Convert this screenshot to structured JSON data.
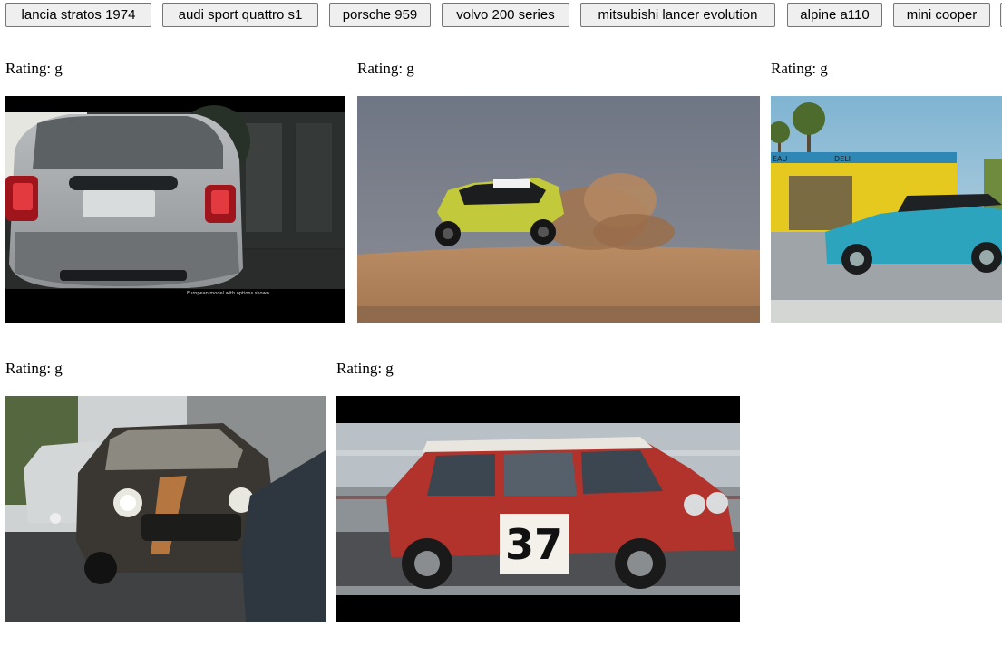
{
  "search_buttons": [
    {
      "label": "lancia stratos 1974"
    },
    {
      "label": "audi sport quattro s1"
    },
    {
      "label": "porsche 959"
    },
    {
      "label": "volvo 200 series"
    },
    {
      "label": "mitsubishi lancer evolution"
    },
    {
      "label": "alpine a110"
    },
    {
      "label": "mini cooper"
    }
  ],
  "results": [
    {
      "rating": "Rating: g",
      "overlay_text": "European model with options shown.",
      "plate_text": ""
    },
    {
      "rating": "Rating: g"
    },
    {
      "rating": "Rating: g",
      "sign_left": "EAU",
      "sign_right": "DELI"
    },
    {
      "rating": "Rating: g"
    },
    {
      "rating": "Rating: g",
      "number": "37"
    }
  ],
  "colors": {
    "button_bg": "#efefef",
    "button_border": "#767676",
    "page_bg": "#ffffff"
  }
}
